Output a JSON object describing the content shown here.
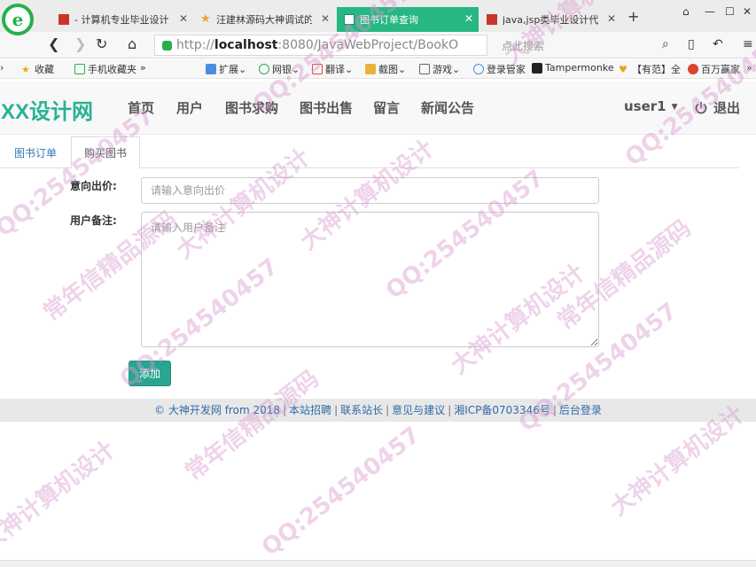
{
  "browser": {
    "tabs": [
      {
        "title": "- 计算机专业毕业设计",
        "icon": "red-square-icon",
        "active": false
      },
      {
        "title": "汪建林源码大神调试的",
        "icon": "star-icon",
        "active": false
      },
      {
        "title": "图书订单查询",
        "icon": "doc-icon",
        "active": true
      },
      {
        "title": "java,jsp类毕业设计代",
        "icon": "red-square-icon",
        "active": false
      }
    ],
    "new_tab": "+",
    "url": {
      "scheme": "http://",
      "host": "localhost",
      "rest": ":8080/JavaWebProject/BookO"
    },
    "search_placeholder": "点此搜索",
    "bookmarks": [
      {
        "label": "收藏",
        "icon": "star-icon"
      },
      {
        "label": "手机收藏夹",
        "icon": "phone-icon"
      },
      {
        "label": "»",
        "icon": ""
      },
      {
        "label": "扩展",
        "icon": "grid-icon"
      },
      {
        "label": "网银",
        "icon": "bank-icon"
      },
      {
        "label": "翻译",
        "icon": "translate-icon"
      },
      {
        "label": "截图",
        "icon": "scissors-icon"
      },
      {
        "label": "游戏",
        "icon": "gamepad-icon"
      },
      {
        "label": "登录管家",
        "icon": "key-icon"
      },
      {
        "label": "Tampermonke",
        "icon": "tampermonkey-icon"
      },
      {
        "label": "【有范】全",
        "icon": "heart-icon"
      },
      {
        "label": "百万赢家",
        "icon": "coin-icon"
      },
      {
        "label": "»",
        "icon": ""
      }
    ]
  },
  "site": {
    "brand": "XX设计网",
    "nav": [
      "首页",
      "用户",
      "图书求购",
      "图书出售",
      "留言",
      "新闻公告"
    ],
    "user": "user1",
    "logout": "退出"
  },
  "tabs": [
    "图书订单",
    "购买图书"
  ],
  "form": {
    "price_label": "意向出价:",
    "price_placeholder": "请输入意向出价",
    "memo_label": "用户备注:",
    "memo_placeholder": "请输入用户备注",
    "submit": "添加"
  },
  "footer": {
    "items": [
      "© 大神开发网 from 2018",
      "本站招聘",
      "联系站长",
      "意见与建议",
      "湘ICP备0703346号",
      "后台登录"
    ],
    "separator": "|"
  },
  "watermark": {
    "texts": [
      "常年信精品源码",
      "QQ:254540457",
      "大神计算机设计"
    ]
  }
}
